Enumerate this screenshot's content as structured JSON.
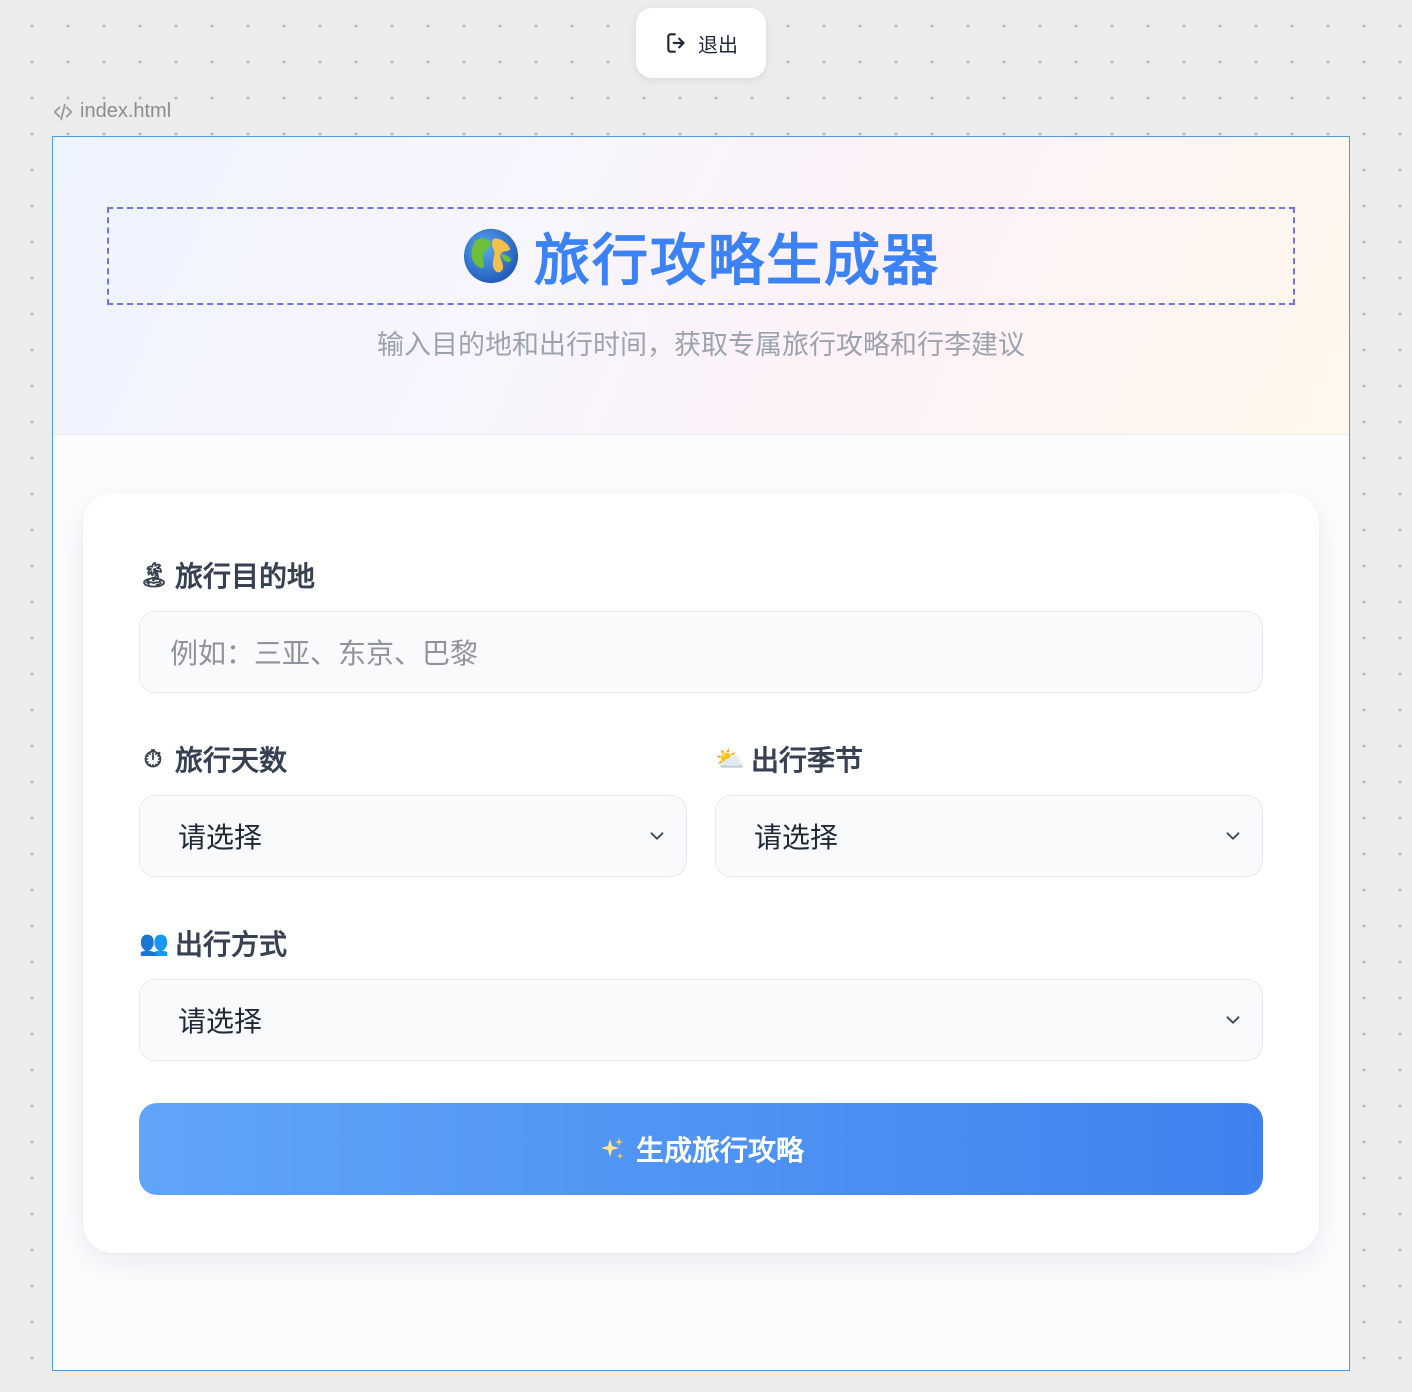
{
  "toolbar": {
    "logout_label": "退出",
    "logout_icon": "logout-icon"
  },
  "file": {
    "name": "index.html",
    "icon": "code-icon"
  },
  "app": {
    "title": "旅行攻略生成器",
    "title_icon": "globe-icon",
    "subtitle": "输入目的地和出行时间，获取专属旅行攻略和行李建议",
    "accent_color": "#3b82f6"
  },
  "form": {
    "destination": {
      "label": "旅行目的地",
      "emoji": "🏝",
      "placeholder": "例如：三亚、东京、巴黎",
      "value": ""
    },
    "days": {
      "label": "旅行天数",
      "emoji": "⏱",
      "selected": "请选择"
    },
    "season": {
      "label": "出行季节",
      "emoji": "⛅",
      "selected": "请选择"
    },
    "travel_mode": {
      "label": "出行方式",
      "emoji": "👥",
      "selected": "请选择"
    },
    "submit_label": "生成旅行攻略",
    "submit_icon": "sparkles-icon"
  }
}
